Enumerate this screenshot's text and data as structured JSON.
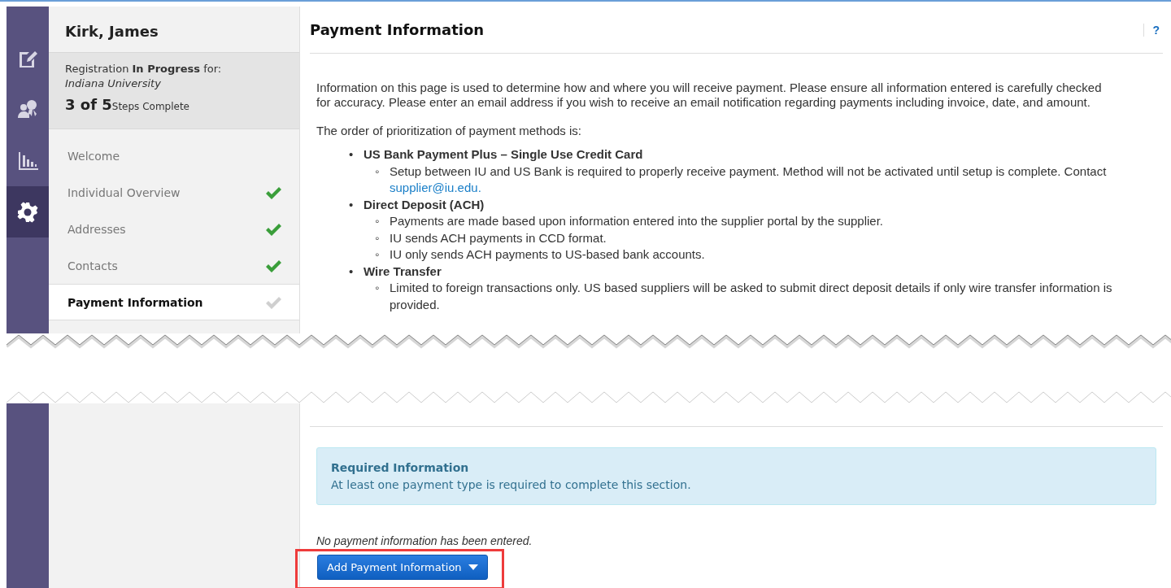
{
  "icon_bar": {
    "items": [
      {
        "kind": "document-edit",
        "selected": false
      },
      {
        "kind": "person-award",
        "selected": false
      },
      {
        "kind": "bar-chart",
        "selected": false
      },
      {
        "kind": "gear",
        "selected": true
      }
    ]
  },
  "sidebar": {
    "name": "Kirk, James",
    "status": {
      "text": "Registration **In Progress** for:",
      "organization": "Indiana University",
      "progress": "3 of 5",
      "progress_label": "Steps Complete"
    },
    "steps": [
      {
        "label": "Welcome",
        "selected": false,
        "checked": false
      },
      {
        "label": "Individual Overview",
        "selected": false,
        "checked": true,
        "done": true
      },
      {
        "label": "Addresses",
        "selected": false,
        "checked": true,
        "done": true
      },
      {
        "label": "Contacts",
        "selected": false,
        "checked": true,
        "done": true
      },
      {
        "label": "Payment Information",
        "selected": true,
        "checked": true,
        "done": false
      }
    ]
  },
  "main": {
    "title": "Payment Information",
    "help": "?",
    "intro": "Information on this page is used to determine how and where you will receive payment. Please ensure all information entered is carefully checked for accuracy. Please enter an email address if you wish to receive an email notification regarding payments including invoice, date, and amount.",
    "order_heading": "The order of prioritization of payment methods is:",
    "methods": [
      {
        "bullet": "•",
        "name": "US Bank Payment Plus – Single Use Credit Card",
        "notes": [
          {
            "bullet": "◦",
            "text": "Setup between IU and US Bank is required to properly receive payment. Method will not be activated until setup is complete. Contact",
            "link": "supplier@iu.edu."
          }
        ]
      },
      {
        "bullet": "•",
        "name": "Direct Deposit (ACH)",
        "notes": [
          {
            "bullet": "◦",
            "text": "Payments are made based upon information entered into the supplier portal by the supplier."
          },
          {
            "bullet": "◦",
            "text": "IU sends ACH payments in CCD format."
          },
          {
            "bullet": "◦",
            "text": "IU only sends ACH payments to US-based bank accounts."
          }
        ]
      },
      {
        "bullet": "•",
        "name": "Wire Transfer",
        "notes": [
          {
            "bullet": "◦",
            "text": "Limited to foreign transactions only. US based suppliers will be asked to submit direct deposit details if only wire transfer information is provided."
          }
        ]
      }
    ],
    "required": {
      "title": "Required Information",
      "text": "At least one payment type is required to complete this section."
    },
    "empty_message": "No payment information has been entered.",
    "add_button": {
      "label": "Add Payment Information",
      "highlighted": true
    }
  }
}
